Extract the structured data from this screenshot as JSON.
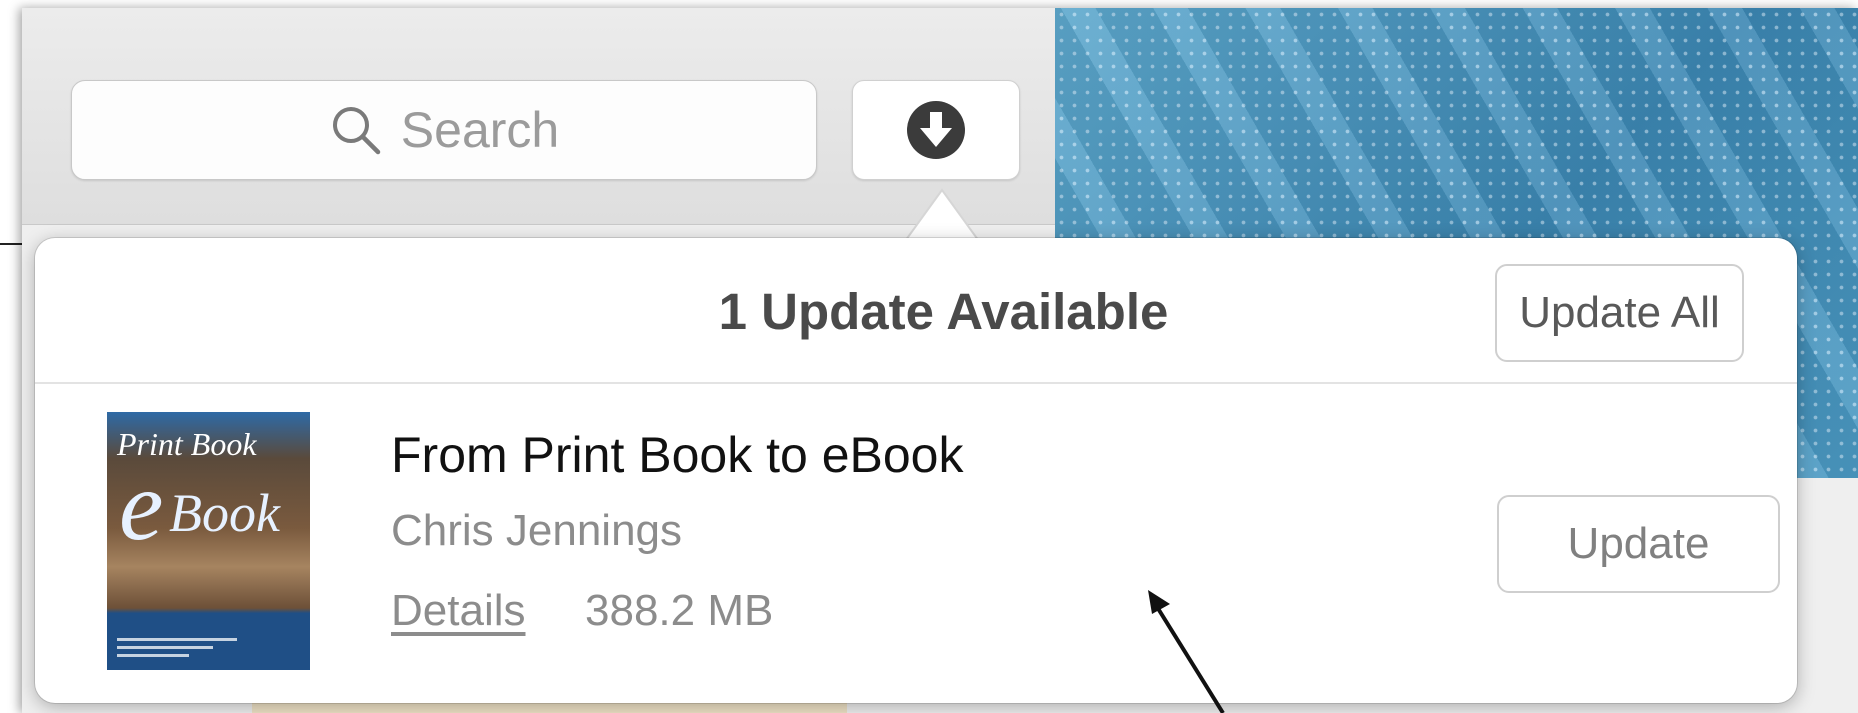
{
  "toolbar": {
    "search_placeholder": "Search",
    "search_icon": "magnifier-icon",
    "downloads_icon": "download-arrow-circle-icon"
  },
  "popover": {
    "title": "1 Update Available",
    "update_all_label": "Update All",
    "items": [
      {
        "title": "From Print Book to eBook",
        "author": "Chris Jennings",
        "details_label": "Details",
        "size": "388.2 MB",
        "update_label": "Update",
        "cover": {
          "top_text": "Print Book",
          "letter": "e",
          "bottom_text": "Book"
        }
      }
    ]
  },
  "background": {
    "partial_text": "........  ......... ....."
  },
  "colors": {
    "accent_blue": "#4a97c2",
    "title_gray": "#4a4a4a",
    "secondary_text": "#8c8c8c"
  }
}
